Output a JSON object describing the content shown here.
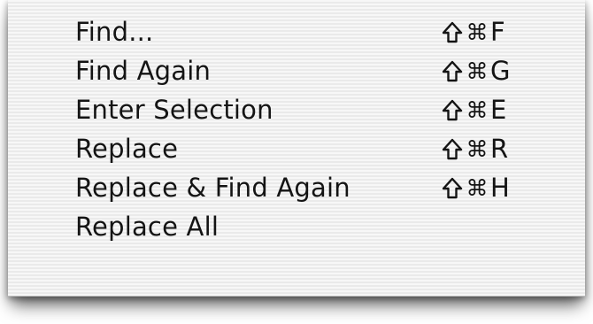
{
  "menu": {
    "items": [
      {
        "label": "Find...",
        "shortcut": {
          "shift": true,
          "cmd": "⌘",
          "key": "F"
        }
      },
      {
        "label": "Find Again",
        "shortcut": {
          "shift": true,
          "cmd": "⌘",
          "key": "G"
        }
      },
      {
        "label": "Enter Selection",
        "shortcut": {
          "shift": true,
          "cmd": "⌘",
          "key": "E"
        }
      },
      {
        "label": "Replace",
        "shortcut": {
          "shift": true,
          "cmd": "⌘",
          "key": "R"
        }
      },
      {
        "label": "Replace & Find Again",
        "shortcut": {
          "shift": true,
          "cmd": "⌘",
          "key": "H"
        }
      },
      {
        "label": "Replace All",
        "shortcut": null
      }
    ]
  },
  "icons": {
    "shift": "shift-icon",
    "command": "command-icon"
  }
}
